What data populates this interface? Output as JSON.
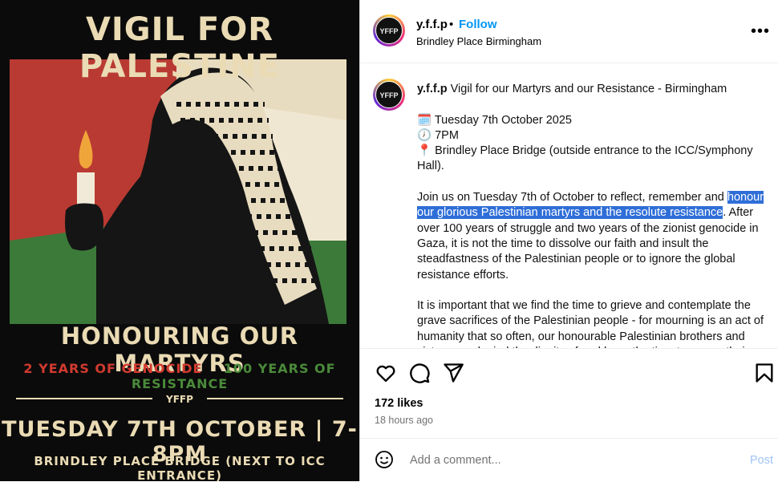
{
  "poster": {
    "title": "VIGIL FOR PALESTINE",
    "subtitle": "HONOURING OUR MARTYRS",
    "tagline_red": "2 YEARS OF GENOCIDE",
    "tagline_green": "100 YEARS OF RESISTANCE",
    "date_line": "TUESDAY 7TH OCTOBER | 7-8PM",
    "location_line": "BRINDLEY PLACE BRIDGE (NEXT TO ICC ENTRANCE)",
    "logo_text": "YFFP",
    "colors": {
      "cream": "#eadbb4",
      "red": "#b93a32",
      "green": "#3c7a3a",
      "background": "#0b0b0b"
    }
  },
  "header": {
    "username": "y.f.f.p",
    "separator": "•",
    "follow_label": "Follow",
    "location": "Brindley Place Birmingham",
    "more_icon": "more-horizontal-icon",
    "avatar_text": "YFFP"
  },
  "caption": {
    "username": "y.f.f.p",
    "title": "Vigil for our Martyrs and our Resistance - Birmingham",
    "date_line": "🗓️ Tuesday 7th October 2025",
    "time_line": "🕖 7PM",
    "location_line": "📍 Brindley Place Bridge (outside entrance to the ICC/Symphony\nHall).",
    "para1_before": "Join us on Tuesday 7th of October to reflect, remember and ",
    "para1_highlight": "honour\nour glorious Palestinian martyrs and the resolute resistance",
    "para1_after": ". After\nover 100 years of struggle and two years of the zionist genocide in\nGaza, it is not the time to dissolve our faith and insult the\nsteadfastness of the Palestinian people or to ignore the global\nresistance efforts.",
    "para2": "It is important that we find the time to grieve and contemplate the\ngrave sacrifices of the Palestinian people - for mourning is an act of\nhumanity that so often, our honourable Palestinian brothers and\nsisters are denied the dignity of and have the time to mourn their"
  },
  "actions": {
    "like_icon": "heart-icon",
    "comment_icon": "comment-icon",
    "share_icon": "send-icon",
    "save_icon": "bookmark-icon",
    "likes": "172 likes",
    "time_ago": "18 hours ago"
  },
  "comment": {
    "emoji_icon": "smiley-icon",
    "placeholder": "Add a comment...",
    "post_label": "Post"
  }
}
